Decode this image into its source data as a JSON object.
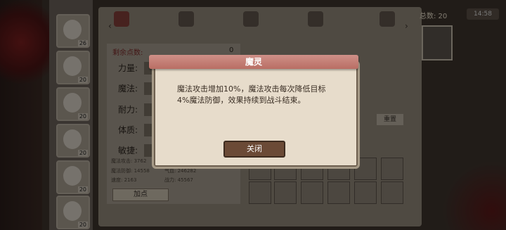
{
  "header": {
    "total_label": "总数: 20",
    "right_badge": "14:58"
  },
  "sidebar": {
    "heroes": [
      {
        "level": "26"
      },
      {
        "level": "20"
      },
      {
        "level": "20"
      },
      {
        "level": "20"
      },
      {
        "level": "20"
      },
      {
        "level": "20"
      }
    ]
  },
  "stats": {
    "remaining_points_label": "剩余点数:",
    "remaining_points_value": "0",
    "power": "力量:",
    "magic": "魔法:",
    "endurance": "耐力:",
    "constitution": "体质:",
    "agility": "敏捷:",
    "magic_attack": "魔法攻击: 3762",
    "magic_defense": "魔法防御: 14558",
    "qi_blood": "气血: 246282",
    "speed": "速度: 2163",
    "tactics": "战力: 45567",
    "add_button": "加点"
  },
  "right_panel": {
    "reset_button": "重置"
  },
  "modal": {
    "title": "魔灵",
    "description_line1": "魔法攻击增加10%，魔法攻击每次降低目标",
    "description_line2": "4%魔法防御，效果持续到战斗结束。",
    "close_button": "关闭"
  }
}
